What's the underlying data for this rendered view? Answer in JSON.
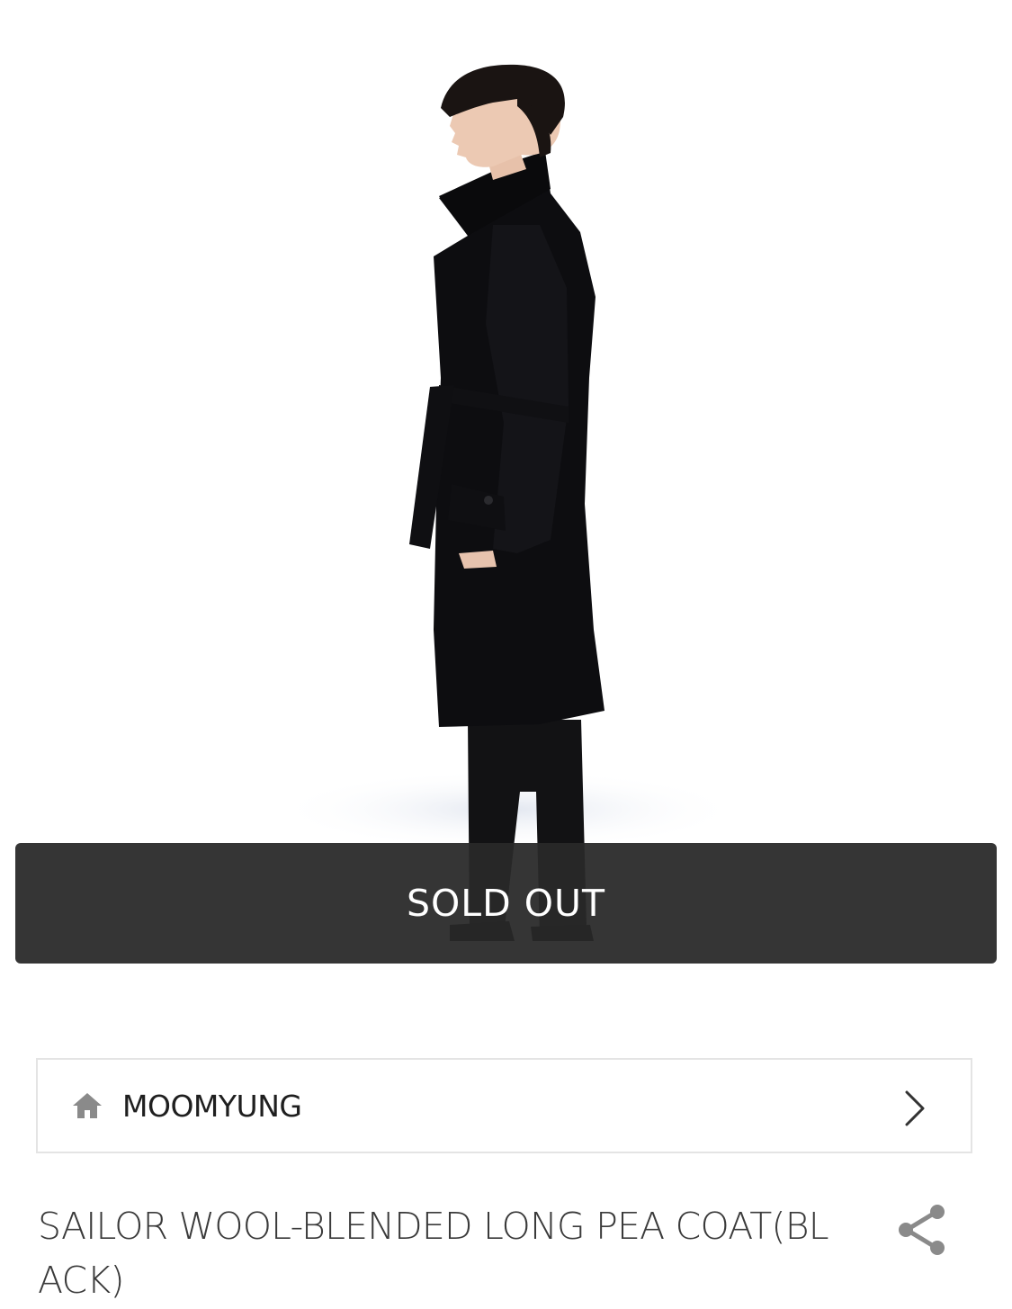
{
  "product": {
    "status_label": "SOLD OUT",
    "brand": "MOOMYUNG",
    "title": "SAILOR WOOL-BLENDED LONG PEA COAT(BLACK)"
  },
  "icons": {
    "brand_home": "home-icon",
    "brand_nav": "chevron-right-icon",
    "share": "share-icon"
  },
  "colors": {
    "soldout_background": "#282828",
    "icon_gray": "#8a8a8a",
    "title_text": "#3a3a3a"
  }
}
